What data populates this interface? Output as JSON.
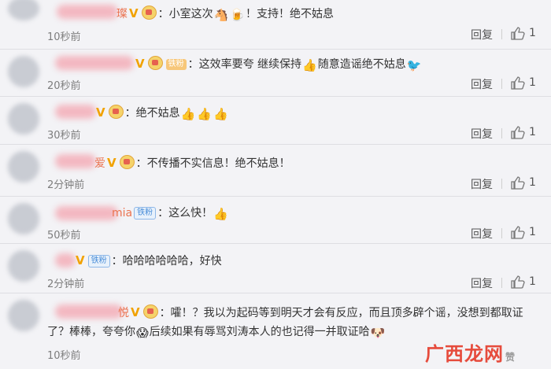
{
  "comments": [
    {
      "name_suffix": "璨",
      "fan_label": "",
      "content": "：小室这次",
      "content2": "！支持！绝不姑息",
      "emojis": [
        "horse",
        "beer"
      ],
      "time": "10秒前"
    },
    {
      "name_suffix": "",
      "fan_label": "铁粉",
      "content": "：这效率要夸 继续保持",
      "content2": "随意造谣绝不姑息",
      "emojis": [
        "thumb",
        "angry-bird"
      ],
      "time": "20秒前"
    },
    {
      "name_suffix": "",
      "fan_label": "",
      "content": "：绝不姑息",
      "content2": "",
      "emojis": [
        "thumb",
        "thumb",
        "thumb"
      ],
      "time": "30秒前"
    },
    {
      "name_suffix": "爱",
      "fan_label": "",
      "content": "：不传播不实信息！绝不姑息！",
      "content2": "",
      "emojis": [],
      "time": "2分钟前"
    },
    {
      "name_suffix": "mia",
      "fan_label": "铁粉",
      "content": "：这么快！",
      "content2": "",
      "emojis": [
        "thumb"
      ],
      "time": "50秒前"
    },
    {
      "name_suffix": "",
      "fan_label": "铁粉",
      "content": "：哈哈哈哈哈哈，好快",
      "content2": "",
      "emojis": [],
      "time": "2分钟前"
    },
    {
      "name_suffix": "悦",
      "fan_label": "",
      "content": "：嚯！？我以为起码等到明天才会有反应，而且顶多辟个谣，没想到都取证",
      "line2_a": "了？棒棒，夸夸你",
      "line2_b": "后续如果有辱骂刘涛本人的也记得一并取证哈",
      "emojis": [
        "scream",
        "dog"
      ],
      "time": "10秒前"
    }
  ],
  "actions": {
    "reply": "回复",
    "like_count": "1"
  },
  "watermark": {
    "text": "广西龙网",
    "small": "赞"
  },
  "icons": {
    "verified": "v-badge-icon",
    "member": "crown-icon",
    "like": "thumbs-up-icon"
  }
}
